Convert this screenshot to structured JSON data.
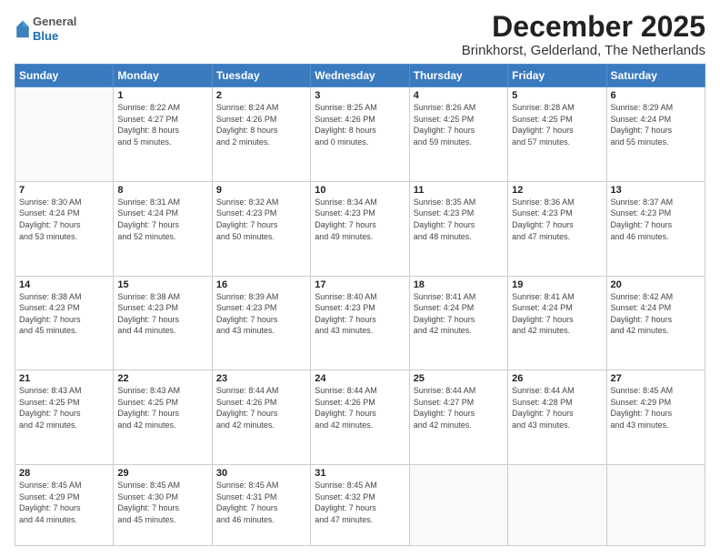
{
  "logo": {
    "general": "General",
    "blue": "Blue"
  },
  "title": {
    "month": "December 2025",
    "location": "Brinkhorst, Gelderland, The Netherlands"
  },
  "headers": [
    "Sunday",
    "Monday",
    "Tuesday",
    "Wednesday",
    "Thursday",
    "Friday",
    "Saturday"
  ],
  "weeks": [
    [
      {
        "day": "",
        "info": ""
      },
      {
        "day": "1",
        "info": "Sunrise: 8:22 AM\nSunset: 4:27 PM\nDaylight: 8 hours\nand 5 minutes."
      },
      {
        "day": "2",
        "info": "Sunrise: 8:24 AM\nSunset: 4:26 PM\nDaylight: 8 hours\nand 2 minutes."
      },
      {
        "day": "3",
        "info": "Sunrise: 8:25 AM\nSunset: 4:26 PM\nDaylight: 8 hours\nand 0 minutes."
      },
      {
        "day": "4",
        "info": "Sunrise: 8:26 AM\nSunset: 4:25 PM\nDaylight: 7 hours\nand 59 minutes."
      },
      {
        "day": "5",
        "info": "Sunrise: 8:28 AM\nSunset: 4:25 PM\nDaylight: 7 hours\nand 57 minutes."
      },
      {
        "day": "6",
        "info": "Sunrise: 8:29 AM\nSunset: 4:24 PM\nDaylight: 7 hours\nand 55 minutes."
      }
    ],
    [
      {
        "day": "7",
        "info": "Sunrise: 8:30 AM\nSunset: 4:24 PM\nDaylight: 7 hours\nand 53 minutes."
      },
      {
        "day": "8",
        "info": "Sunrise: 8:31 AM\nSunset: 4:24 PM\nDaylight: 7 hours\nand 52 minutes."
      },
      {
        "day": "9",
        "info": "Sunrise: 8:32 AM\nSunset: 4:23 PM\nDaylight: 7 hours\nand 50 minutes."
      },
      {
        "day": "10",
        "info": "Sunrise: 8:34 AM\nSunset: 4:23 PM\nDaylight: 7 hours\nand 49 minutes."
      },
      {
        "day": "11",
        "info": "Sunrise: 8:35 AM\nSunset: 4:23 PM\nDaylight: 7 hours\nand 48 minutes."
      },
      {
        "day": "12",
        "info": "Sunrise: 8:36 AM\nSunset: 4:23 PM\nDaylight: 7 hours\nand 47 minutes."
      },
      {
        "day": "13",
        "info": "Sunrise: 8:37 AM\nSunset: 4:23 PM\nDaylight: 7 hours\nand 46 minutes."
      }
    ],
    [
      {
        "day": "14",
        "info": "Sunrise: 8:38 AM\nSunset: 4:23 PM\nDaylight: 7 hours\nand 45 minutes."
      },
      {
        "day": "15",
        "info": "Sunrise: 8:38 AM\nSunset: 4:23 PM\nDaylight: 7 hours\nand 44 minutes."
      },
      {
        "day": "16",
        "info": "Sunrise: 8:39 AM\nSunset: 4:23 PM\nDaylight: 7 hours\nand 43 minutes."
      },
      {
        "day": "17",
        "info": "Sunrise: 8:40 AM\nSunset: 4:23 PM\nDaylight: 7 hours\nand 43 minutes."
      },
      {
        "day": "18",
        "info": "Sunrise: 8:41 AM\nSunset: 4:24 PM\nDaylight: 7 hours\nand 42 minutes."
      },
      {
        "day": "19",
        "info": "Sunrise: 8:41 AM\nSunset: 4:24 PM\nDaylight: 7 hours\nand 42 minutes."
      },
      {
        "day": "20",
        "info": "Sunrise: 8:42 AM\nSunset: 4:24 PM\nDaylight: 7 hours\nand 42 minutes."
      }
    ],
    [
      {
        "day": "21",
        "info": "Sunrise: 8:43 AM\nSunset: 4:25 PM\nDaylight: 7 hours\nand 42 minutes."
      },
      {
        "day": "22",
        "info": "Sunrise: 8:43 AM\nSunset: 4:25 PM\nDaylight: 7 hours\nand 42 minutes."
      },
      {
        "day": "23",
        "info": "Sunrise: 8:44 AM\nSunset: 4:26 PM\nDaylight: 7 hours\nand 42 minutes."
      },
      {
        "day": "24",
        "info": "Sunrise: 8:44 AM\nSunset: 4:26 PM\nDaylight: 7 hours\nand 42 minutes."
      },
      {
        "day": "25",
        "info": "Sunrise: 8:44 AM\nSunset: 4:27 PM\nDaylight: 7 hours\nand 42 minutes."
      },
      {
        "day": "26",
        "info": "Sunrise: 8:44 AM\nSunset: 4:28 PM\nDaylight: 7 hours\nand 43 minutes."
      },
      {
        "day": "27",
        "info": "Sunrise: 8:45 AM\nSunset: 4:29 PM\nDaylight: 7 hours\nand 43 minutes."
      }
    ],
    [
      {
        "day": "28",
        "info": "Sunrise: 8:45 AM\nSunset: 4:29 PM\nDaylight: 7 hours\nand 44 minutes."
      },
      {
        "day": "29",
        "info": "Sunrise: 8:45 AM\nSunset: 4:30 PM\nDaylight: 7 hours\nand 45 minutes."
      },
      {
        "day": "30",
        "info": "Sunrise: 8:45 AM\nSunset: 4:31 PM\nDaylight: 7 hours\nand 46 minutes."
      },
      {
        "day": "31",
        "info": "Sunrise: 8:45 AM\nSunset: 4:32 PM\nDaylight: 7 hours\nand 47 minutes."
      },
      {
        "day": "",
        "info": ""
      },
      {
        "day": "",
        "info": ""
      },
      {
        "day": "",
        "info": ""
      }
    ]
  ]
}
